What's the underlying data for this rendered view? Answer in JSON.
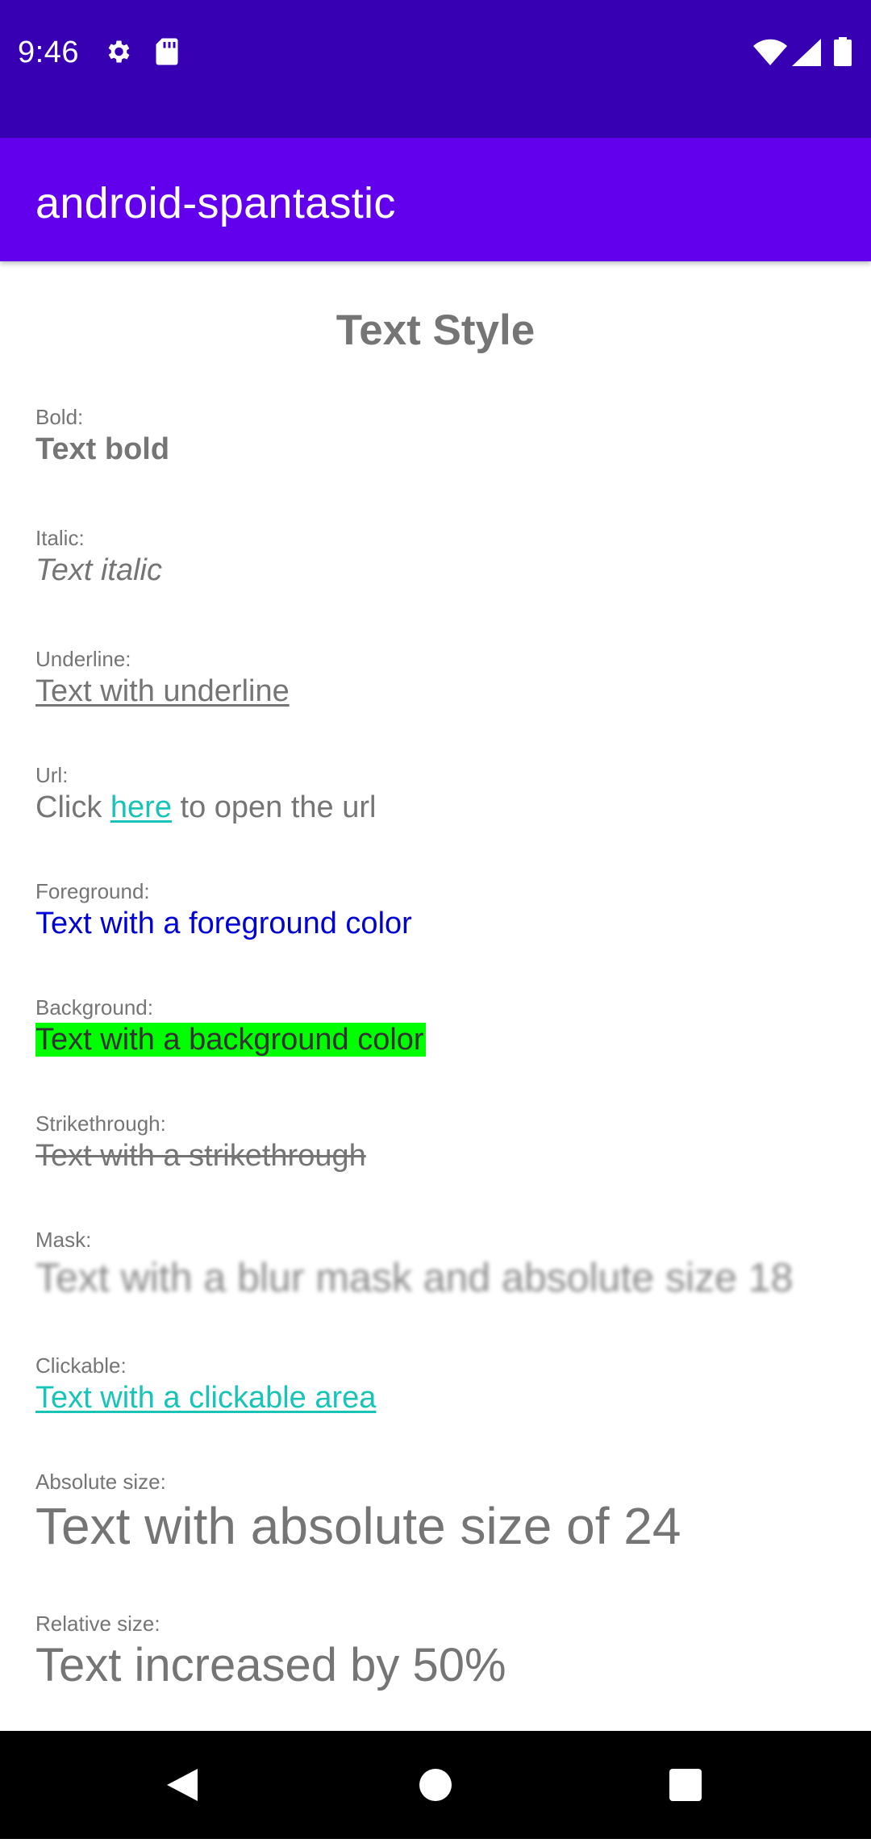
{
  "status_bar": {
    "time": "9:46",
    "icons": [
      "gear-icon",
      "sd-card-icon",
      "wifi-icon",
      "signal-icon",
      "battery-icon"
    ]
  },
  "app_bar": {
    "title": "android-spantastic"
  },
  "content": {
    "heading": "Text Style",
    "items": [
      {
        "label": "Bold:",
        "value": "Text bold"
      },
      {
        "label": "Italic:",
        "value": "Text italic"
      },
      {
        "label": "Underline:",
        "value": "Text with underline"
      },
      {
        "label": "Url:",
        "before": "Click ",
        "link": "here",
        "after": " to open the url"
      },
      {
        "label": "Foreground:",
        "value": "Text with a foreground color"
      },
      {
        "label": "Background:",
        "value": "Text with a background color"
      },
      {
        "label": "Strikethrough:",
        "value": "Text with a strikethrough"
      },
      {
        "label": "Mask:",
        "value": "Text with a blur mask and absolute size 18"
      },
      {
        "label": "Clickable:",
        "value": "Text with a clickable area"
      },
      {
        "label": "Absolute size:",
        "value": "Text with absolute size of 24"
      },
      {
        "label": "Relative size:",
        "value": "Text increased by 50%"
      }
    ]
  },
  "colors": {
    "status_bar": "#3700B3",
    "app_bar": "#6200EE",
    "link": "#18C3B8",
    "foreground": "#0000D6",
    "background_highlight": "#00FF00",
    "text_gray": "#757575"
  },
  "nav_bar": {
    "icons": [
      "back-icon",
      "home-icon",
      "recents-icon"
    ]
  }
}
